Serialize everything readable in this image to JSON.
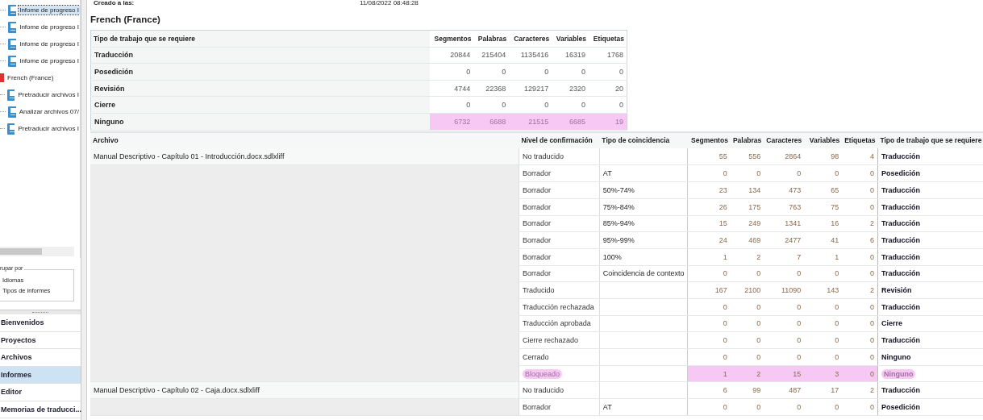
{
  "sidebar": {
    "tree": [
      {
        "label": "Infome de progreso I",
        "kind": "report",
        "selected": true
      },
      {
        "label": "Infome de progreso I",
        "kind": "report",
        "selected": false
      },
      {
        "label": "Infome de progreso I",
        "kind": "report",
        "selected": false
      },
      {
        "label": "Infome de progreso I",
        "kind": "report",
        "selected": false
      },
      {
        "label": "French (France)",
        "kind": "language",
        "selected": false,
        "children": [
          {
            "label": "Pretraducir archivos I",
            "kind": "report",
            "selected": false
          },
          {
            "label": "Analizar archivos 07/",
            "kind": "report",
            "selected": false
          },
          {
            "label": "Pretraducir archivos I",
            "kind": "report",
            "selected": false
          }
        ]
      }
    ],
    "group_by": {
      "title": "rupar por",
      "options": [
        {
          "label": "Idiomas"
        },
        {
          "label": "Tipos de informes"
        }
      ]
    },
    "nav": [
      {
        "label": "Bienvenidos",
        "selected": false
      },
      {
        "label": "Proyectos",
        "selected": false
      },
      {
        "label": "Archivos",
        "selected": false
      },
      {
        "label": "Informes",
        "selected": true
      },
      {
        "label": "Editor",
        "selected": false
      },
      {
        "label": "Memorias de traducci...",
        "selected": false
      }
    ]
  },
  "report": {
    "created_label": "Creado a las:",
    "created_value": "11/08/2022 08:48:28",
    "language": "French (France)",
    "summary": {
      "columns": [
        "Tipo de trabajo que se requiere",
        "Segmentos",
        "Palabras",
        "Caracteres",
        "Variables",
        "Etiquetas"
      ],
      "rows": [
        {
          "label": "Traducción",
          "values": [
            "20844",
            "215404",
            "1135416",
            "16319",
            "1768"
          ],
          "highlighted": false
        },
        {
          "label": "Posedición",
          "values": [
            "0",
            "0",
            "0",
            "0",
            "0"
          ],
          "highlighted": false
        },
        {
          "label": "Revisión",
          "values": [
            "4744",
            "22368",
            "129217",
            "2320",
            "20"
          ],
          "highlighted": false
        },
        {
          "label": "Cierre",
          "values": [
            "0",
            "0",
            "0",
            "0",
            "0"
          ],
          "highlighted": false
        },
        {
          "label": "Ninguno",
          "values": [
            "6732",
            "6688",
            "21515",
            "6685",
            "19"
          ],
          "highlighted": true
        }
      ]
    },
    "detail": {
      "columns": [
        "Archivo",
        "Nivel de confirmación",
        "Tipo de coincidencia",
        "Segmentos",
        "Palabras",
        "Caracteres",
        "Variables",
        "Etiquetas",
        "Tipo de trabajo que se requiere"
      ],
      "files": [
        {
          "name": "Manual Descriptivo - Capítulo 01 - Introducción.docx.sdlxliff",
          "rows": [
            {
              "level": "No traducido",
              "match": "",
              "values": [
                "55",
                "556",
                "2864",
                "98",
                "4"
              ],
              "job": "Traducción",
              "highlighted": false
            },
            {
              "level": "Borrador",
              "match": "AT",
              "values": [
                "0",
                "0",
                "0",
                "0",
                "0"
              ],
              "job": "Posedición",
              "highlighted": false
            },
            {
              "level": "Borrador",
              "match": "50%-74%",
              "values": [
                "23",
                "134",
                "473",
                "65",
                "0"
              ],
              "job": "Traducción",
              "highlighted": false
            },
            {
              "level": "Borrador",
              "match": "75%-84%",
              "values": [
                "26",
                "175",
                "763",
                "75",
                "0"
              ],
              "job": "Traducción",
              "highlighted": false
            },
            {
              "level": "Borrador",
              "match": "85%-94%",
              "values": [
                "15",
                "249",
                "1341",
                "16",
                "2"
              ],
              "job": "Traducción",
              "highlighted": false
            },
            {
              "level": "Borrador",
              "match": "95%-99%",
              "values": [
                "24",
                "469",
                "2477",
                "41",
                "6"
              ],
              "job": "Traducción",
              "highlighted": false
            },
            {
              "level": "Borrador",
              "match": "100%",
              "values": [
                "1",
                "2",
                "7",
                "1",
                "0"
              ],
              "job": "Traducción",
              "highlighted": false
            },
            {
              "level": "Borrador",
              "match": "Coincidencia de contexto",
              "values": [
                "0",
                "0",
                "0",
                "0",
                "0"
              ],
              "job": "Traducción",
              "highlighted": false
            },
            {
              "level": "Traducido",
              "match": "",
              "values": [
                "167",
                "2100",
                "11090",
                "143",
                "2"
              ],
              "job": "Revisión",
              "highlighted": false
            },
            {
              "level": "Traducción rechazada",
              "match": "",
              "values": [
                "0",
                "0",
                "0",
                "0",
                "0"
              ],
              "job": "Traducción",
              "highlighted": false
            },
            {
              "level": "Traducción aprobada",
              "match": "",
              "values": [
                "0",
                "0",
                "0",
                "0",
                "0"
              ],
              "job": "Cierre",
              "highlighted": false
            },
            {
              "level": "Cierre rechazado",
              "match": "",
              "values": [
                "0",
                "0",
                "0",
                "0",
                "0"
              ],
              "job": "Traducción",
              "highlighted": false
            },
            {
              "level": "Cerrado",
              "match": "",
              "values": [
                "0",
                "0",
                "0",
                "0",
                "0"
              ],
              "job": "Ninguno",
              "highlighted": false
            },
            {
              "level": "Bloqueado",
              "match": "",
              "values": [
                "1",
                "2",
                "15",
                "3",
                "0"
              ],
              "job": "Ninguno",
              "highlighted": true
            }
          ]
        },
        {
          "name": "Manual Descriptivo - Capítulo 02 - Caja.docx.sdlxliff",
          "rows": [
            {
              "level": "No traducido",
              "match": "",
              "values": [
                "6",
                "99",
                "487",
                "17",
                "2"
              ],
              "job": "Traducción",
              "highlighted": false
            },
            {
              "level": "Borrador",
              "match": "AT",
              "values": [
                "0",
                "0",
                "0",
                "0",
                "0"
              ],
              "job": "Posedición",
              "highlighted": false
            }
          ]
        }
      ]
    }
  }
}
